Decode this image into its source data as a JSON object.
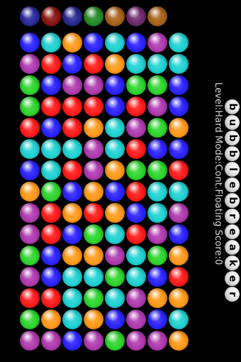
{
  "game": {
    "title": "bubble breaker",
    "status": "Level:Hard Mode:Cont.Floating Score:0"
  },
  "colors": {
    "blue": "#2c22ff",
    "red": "#ff1a1a",
    "green": "#2ed62e",
    "orange": "#ff9a1a",
    "purple": "#b03ab0",
    "teal": "#20d2d2",
    "dark_blue": "#2a2a9c",
    "dark_red": "#8a1414",
    "dark_navy": "#28288c",
    "dark_green": "#268a26",
    "dark_orange": "#a8621a",
    "dark_purple": "#6e2a6e"
  },
  "next_row": [
    "dark_blue",
    "dark_red",
    "dark_navy",
    "dark_green",
    "dark_orange",
    "dark_purple",
    "dark_orange"
  ],
  "board": [
    [
      "blue",
      "teal",
      "orange",
      "blue",
      "teal",
      "blue",
      "purple",
      "teal"
    ],
    [
      "purple",
      "red",
      "blue",
      "red",
      "orange",
      "teal",
      "teal",
      "teal"
    ],
    [
      "green",
      "blue",
      "purple",
      "purple",
      "blue",
      "green",
      "green",
      "blue"
    ],
    [
      "green",
      "red",
      "red",
      "red",
      "blue",
      "red",
      "purple",
      "blue"
    ],
    [
      "red",
      "blue",
      "red",
      "orange",
      "teal",
      "purple",
      "green",
      "orange"
    ],
    [
      "teal",
      "teal",
      "teal",
      "purple",
      "teal",
      "red",
      "blue",
      "blue"
    ],
    [
      "blue",
      "teal",
      "red",
      "purple",
      "orange",
      "green",
      "green",
      "red"
    ],
    [
      "orange",
      "green",
      "blue",
      "orange",
      "blue",
      "red",
      "teal",
      "teal"
    ],
    [
      "purple",
      "red",
      "orange",
      "red",
      "orange",
      "blue",
      "teal",
      "purple"
    ],
    [
      "purple",
      "red",
      "blue",
      "green",
      "teal",
      "red",
      "purple",
      "blue"
    ],
    [
      "green",
      "blue",
      "orange",
      "orange",
      "purple",
      "teal",
      "green",
      "orange"
    ],
    [
      "purple",
      "blue",
      "teal",
      "teal",
      "green",
      "teal",
      "blue",
      "red"
    ],
    [
      "red",
      "red",
      "teal",
      "green",
      "teal",
      "purple",
      "orange",
      "orange"
    ],
    [
      "green",
      "orange",
      "teal",
      "orange",
      "blue",
      "purple",
      "blue",
      "teal"
    ],
    [
      "purple",
      "purple",
      "blue",
      "purple",
      "green",
      "purple",
      "purple",
      "orange"
    ]
  ]
}
